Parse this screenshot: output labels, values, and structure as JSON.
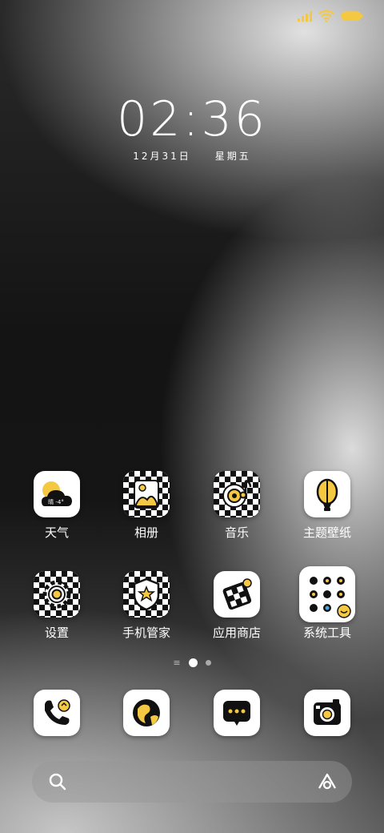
{
  "status_bar": {
    "signal_icon": "signal-bars-icon",
    "wifi_icon": "wifi-icon",
    "battery_icon": "battery-icon",
    "accent_color": "#F5C842"
  },
  "clock": {
    "time": "02:36",
    "date": "12月31日",
    "weekday": "星期五"
  },
  "apps_row1": [
    {
      "label": "天气",
      "weather_text": "晴 -4°"
    },
    {
      "label": "相册"
    },
    {
      "label": "音乐"
    },
    {
      "label": "主题壁纸"
    }
  ],
  "apps_row2": [
    {
      "label": "设置"
    },
    {
      "label": "手机管家"
    },
    {
      "label": "应用商店"
    },
    {
      "label": "系统工具"
    }
  ],
  "page_indicator": {
    "pages": 2,
    "current": 1
  },
  "dock": [
    {
      "name": "phone"
    },
    {
      "name": "browser"
    },
    {
      "name": "messages"
    },
    {
      "name": "camera"
    }
  ],
  "search_bar": {
    "search_icon": "search-icon",
    "assistant_icon": "assistant-icon"
  }
}
